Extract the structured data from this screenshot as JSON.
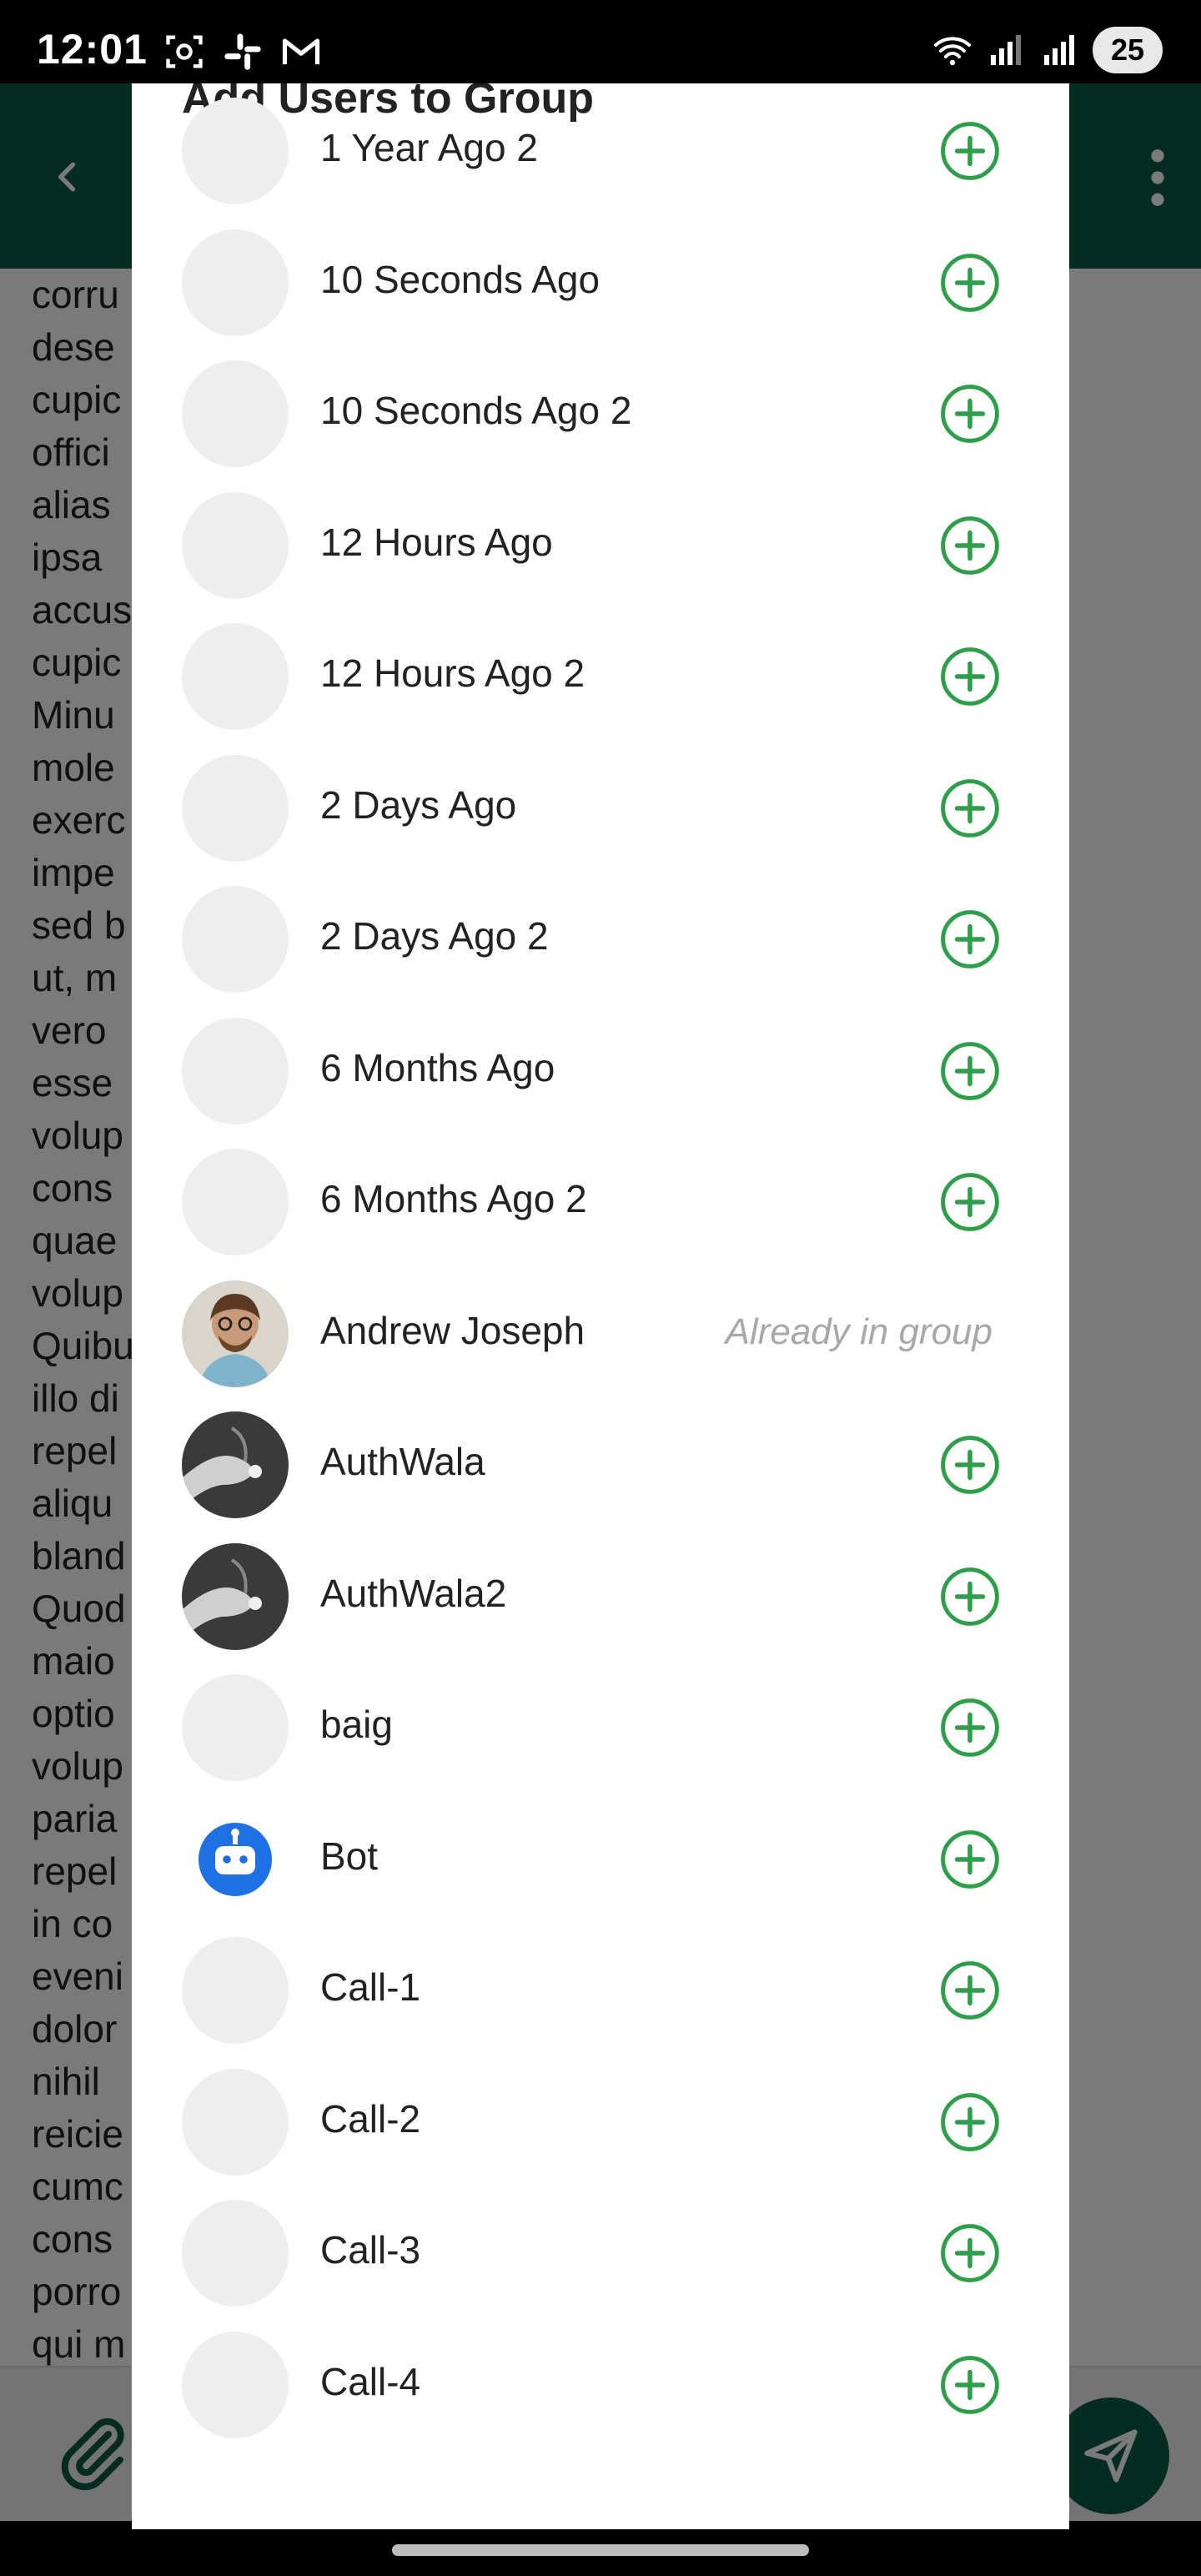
{
  "status_bar": {
    "time": "12:01",
    "battery": "25",
    "left_icons": [
      "screenshot-icon",
      "slack-icon",
      "gmail-icon"
    ],
    "right_icons": [
      "wifi-icon",
      "signal-icon",
      "signal-icon-2"
    ]
  },
  "background": {
    "lines": [
      "corru",
      "dese",
      "cupic",
      "offici",
      "alias",
      "ipsa",
      "accus",
      "cupic",
      "Minu",
      "mole",
      "exerc",
      "impe",
      "sed b",
      "ut, m",
      "vero",
      "esse",
      "volup",
      "cons",
      "quae",
      "volup",
      "Quibu",
      "illo di",
      "repel",
      "aliqu",
      "bland",
      "Quod",
      "maio",
      "optio",
      "volup",
      "paria",
      "repel",
      "in co",
      "eveni",
      "dolor",
      "nihil",
      "reicie",
      "cumc",
      "cons",
      "porro",
      "qui m"
    ]
  },
  "dialog": {
    "title": "Add Users to Group",
    "already_label": "Already in group",
    "users": [
      {
        "name": "1 Year Ago 2",
        "avatar": "placeholder",
        "in_group": false
      },
      {
        "name": "10 Seconds Ago",
        "avatar": "placeholder",
        "in_group": false
      },
      {
        "name": "10 Seconds Ago 2",
        "avatar": "placeholder",
        "in_group": false
      },
      {
        "name": "12 Hours Ago",
        "avatar": "placeholder",
        "in_group": false
      },
      {
        "name": "12 Hours Ago 2",
        "avatar": "placeholder",
        "in_group": false
      },
      {
        "name": "2 Days Ago",
        "avatar": "placeholder",
        "in_group": false
      },
      {
        "name": "2 Days Ago 2",
        "avatar": "placeholder",
        "in_group": false
      },
      {
        "name": "6 Months Ago",
        "avatar": "placeholder",
        "in_group": false
      },
      {
        "name": "6 Months Ago 2",
        "avatar": "placeholder",
        "in_group": false
      },
      {
        "name": "Andrew Joseph",
        "avatar": "person-photo",
        "in_group": true
      },
      {
        "name": "AuthWala",
        "avatar": "hand-photo",
        "in_group": false
      },
      {
        "name": "AuthWala2",
        "avatar": "hand-photo",
        "in_group": false
      },
      {
        "name": "baig",
        "avatar": "placeholder",
        "in_group": false
      },
      {
        "name": "Bot",
        "avatar": "bot-icon",
        "in_group": false
      },
      {
        "name": "Call-1",
        "avatar": "placeholder",
        "in_group": false
      },
      {
        "name": "Call-2",
        "avatar": "placeholder",
        "in_group": false
      },
      {
        "name": "Call-3",
        "avatar": "placeholder",
        "in_group": false
      },
      {
        "name": "Call-4",
        "avatar": "placeholder",
        "in_group": false
      }
    ]
  },
  "colors": {
    "header": "#0d5a44",
    "add_icon": "#2e9e4a",
    "bot_blue": "#1f6fe5",
    "muted_text": "#a8a8a8"
  }
}
